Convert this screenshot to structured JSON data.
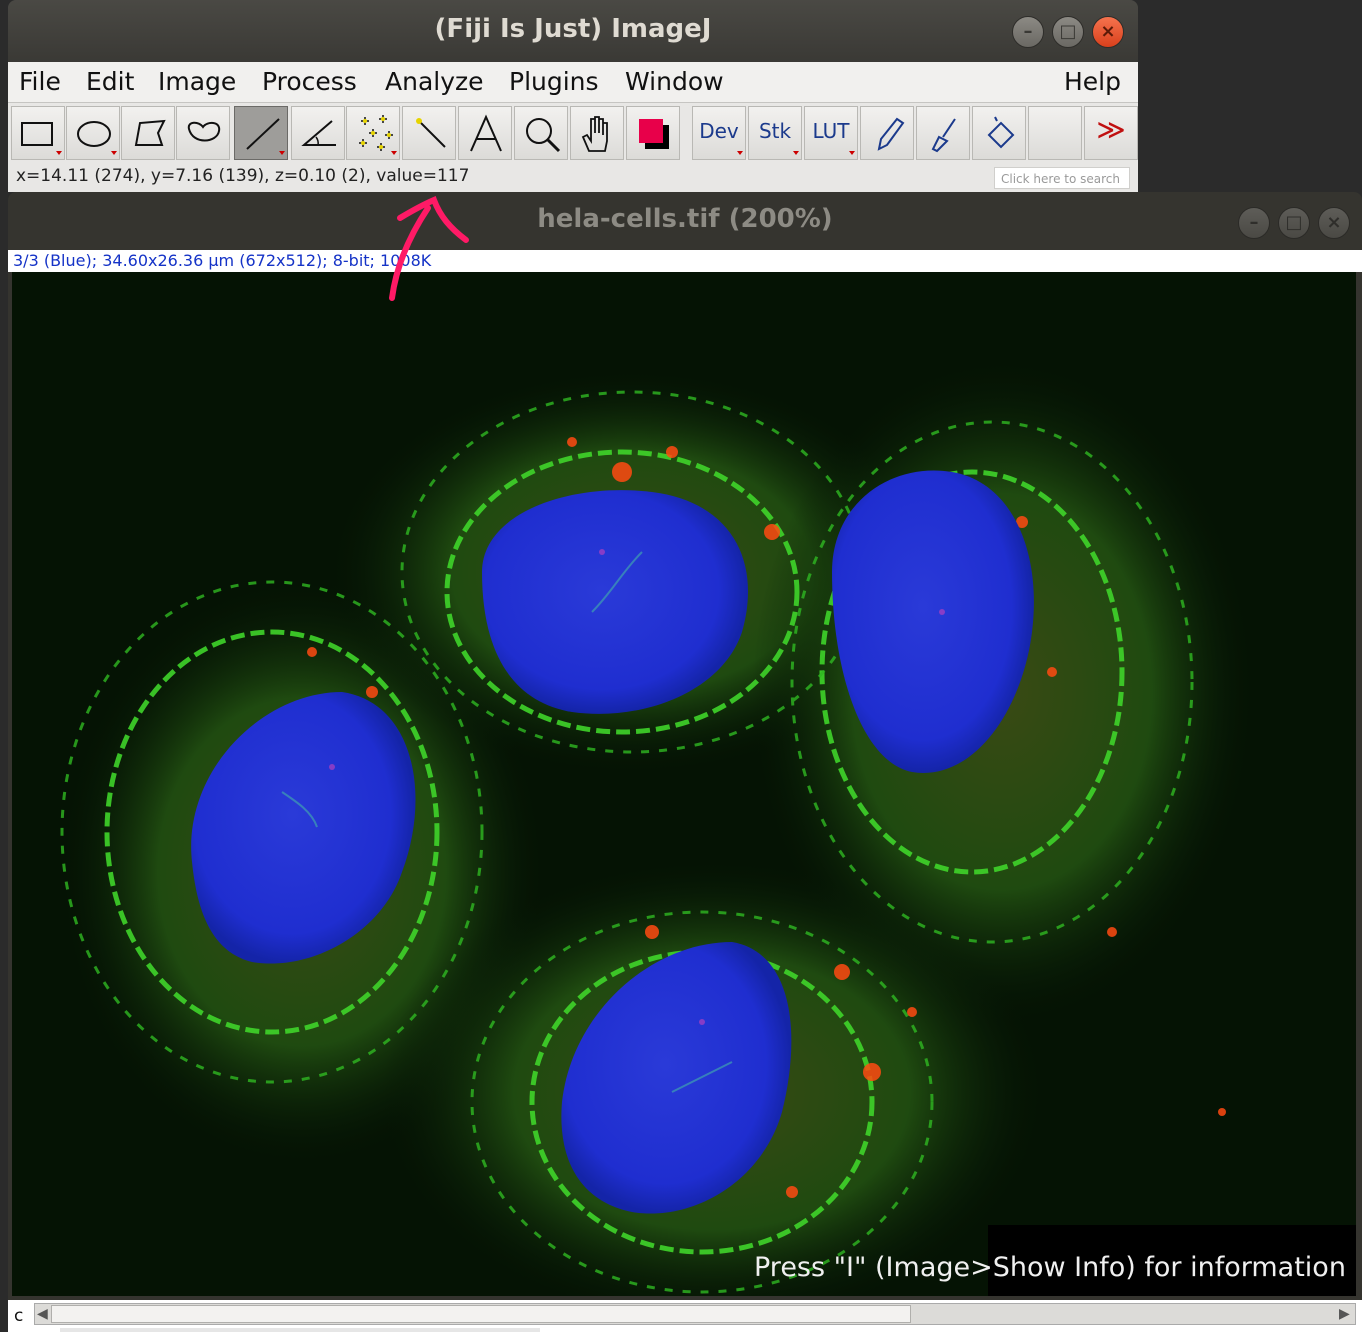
{
  "main_window": {
    "title": "(Fiji Is Just) ImageJ",
    "menu": [
      "File",
      "Edit",
      "Image",
      "Process",
      "Analyze",
      "Plugins",
      "Window",
      "Help"
    ],
    "toolbar": {
      "tools": [
        "rectangle-tool",
        "oval-tool",
        "polygon-tool",
        "freehand-tool",
        "line-tool",
        "angle-tool",
        "multipoint-tool",
        "wand-tool",
        "text-tool",
        "magnifier-tool",
        "scroll-tool",
        "color-picker"
      ],
      "dev_label": "Dev",
      "stk_label": "Stk",
      "lut_label": "LUT",
      "more_label": "≫"
    },
    "status": "x=14.11 (274), y=7.16 (139), z=0.10 (2), value=117",
    "search_placeholder": "Click here to search"
  },
  "image_window": {
    "title": "hela-cells.tif (200%)",
    "info": "3/3 (Blue); 34.60x26.36 µm (672x512); 8-bit; 1008K",
    "overlay_message": "Press \"I\" (Image>Show Info) for information",
    "channel_label": "c"
  },
  "colors": {
    "accent_red": "#e8004a",
    "link_blue": "#1533c7",
    "annotation_pink": "#ff1a66"
  }
}
